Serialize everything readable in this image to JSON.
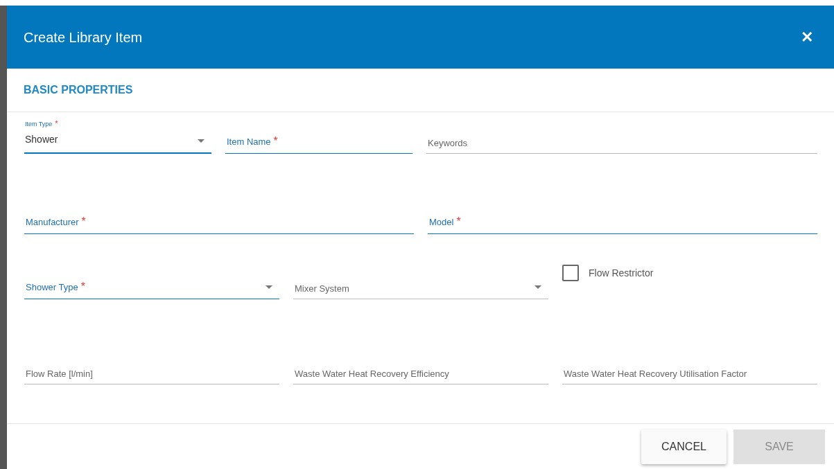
{
  "dialog": {
    "title": "Create Library Item",
    "close_icon": "✕"
  },
  "section": {
    "title": "BASIC PROPERTIES"
  },
  "rows": [
    {
      "fields": [
        {
          "kind": "select",
          "label": "Item Type",
          "value": "Shower",
          "required_mark": "*",
          "active": true
        },
        {
          "kind": "text",
          "label": "Item Name",
          "required_mark": "*",
          "active": true
        },
        {
          "kind": "text",
          "label": "Keywords",
          "active": false
        }
      ]
    },
    {
      "fields": [
        {
          "kind": "text",
          "label": "Manufacturer",
          "required_mark": "*",
          "active": true
        },
        {
          "kind": "text",
          "label": "Model",
          "required_mark": "*",
          "active": true
        }
      ]
    },
    {
      "fields": [
        {
          "kind": "select",
          "label": "Shower Type",
          "required_mark": "*",
          "active": true
        },
        {
          "kind": "select",
          "label": "Mixer System",
          "active": false
        },
        {
          "kind": "checkbox",
          "label": "Flow Restrictor",
          "checked": false
        }
      ]
    },
    {
      "fields": [
        {
          "kind": "text",
          "label": "Flow Rate [l/min]",
          "active": false
        },
        {
          "kind": "text",
          "label": "Waste Water Heat Recovery Efficiency",
          "active": false
        },
        {
          "kind": "text",
          "label": "Waste Water Heat Recovery Utilisation Factor",
          "active": false
        }
      ]
    }
  ],
  "buttons": [
    {
      "label": "CANCEL",
      "disabled": false
    },
    {
      "label": "SAVE",
      "disabled": true
    }
  ]
}
